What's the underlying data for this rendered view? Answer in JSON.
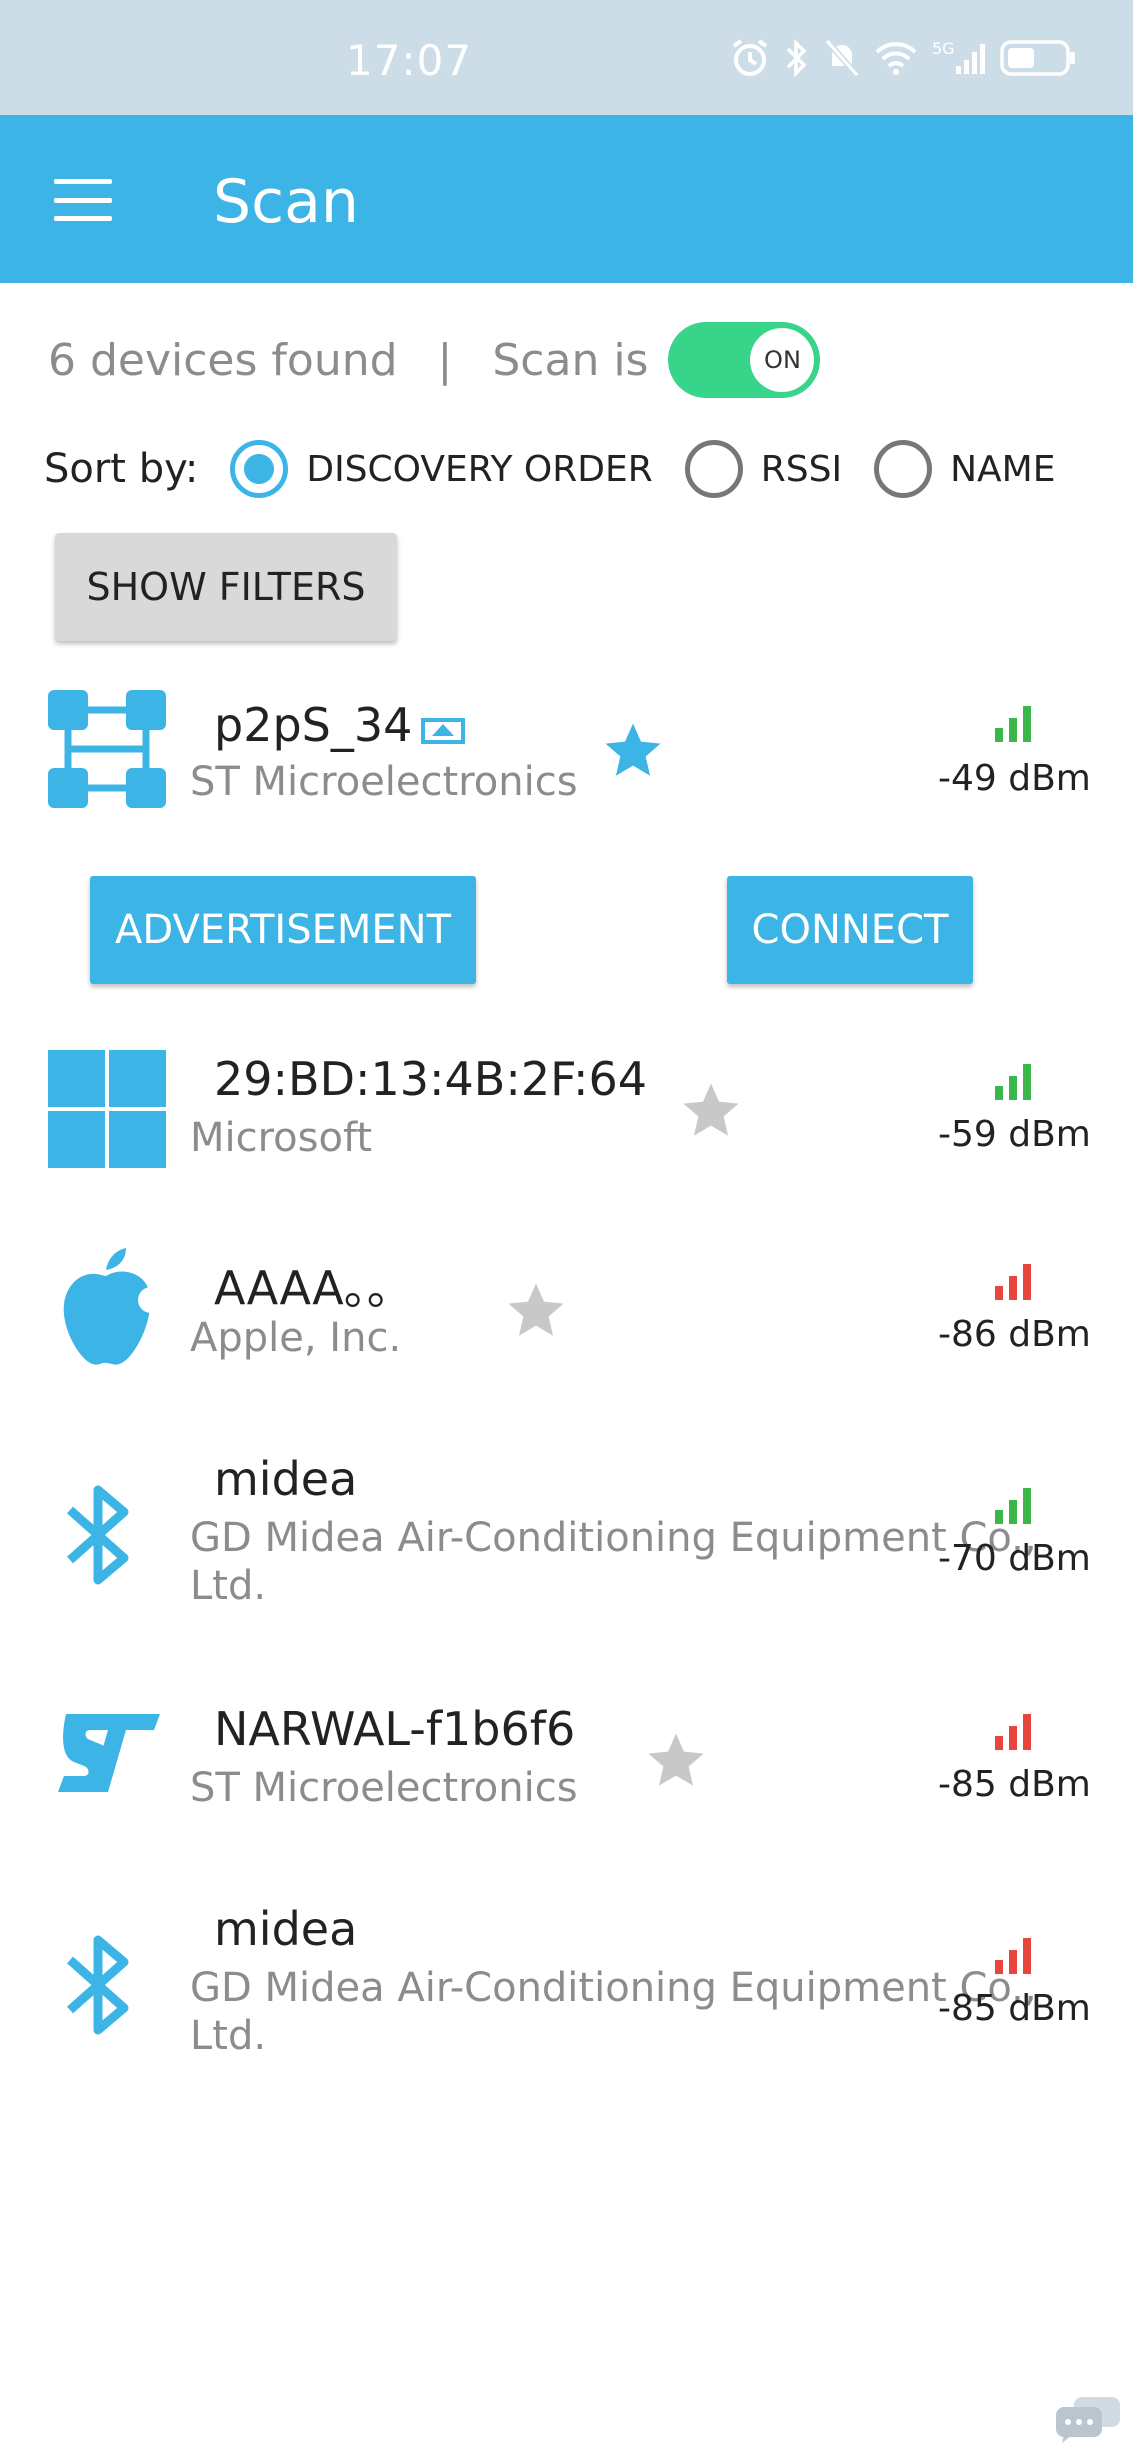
{
  "status_bar": {
    "time": "17:07",
    "icons": [
      "alarm-icon",
      "bluetooth-icon",
      "mute-icon",
      "wifi-icon",
      "5g-signal-icon",
      "battery-icon"
    ]
  },
  "app_bar": {
    "title": "Scan",
    "menu_icon": "hamburger-menu-icon",
    "color": "#3cb4e5"
  },
  "scan_info": {
    "devices_found": "6 devices found",
    "divider": "|",
    "scan_label": "Scan is",
    "toggle_state": "ON",
    "toggle_color": "#38d48a"
  },
  "sort": {
    "label": "Sort by:",
    "options": [
      {
        "label": "DISCOVERY ORDER",
        "selected": true
      },
      {
        "label": "RSSI",
        "selected": false
      },
      {
        "label": "NAME",
        "selected": false
      }
    ]
  },
  "filters_button": "SHOW FILTERS",
  "devices": [
    {
      "name": "p2pS_34",
      "manufacturer": "ST Microelectronics",
      "icon": "network-nodes-icon",
      "favorite": true,
      "rssi": "-49 dBm",
      "signal": "strong",
      "expanded": true,
      "advertisement_label": "ADVERTISEMENT",
      "connect_label": "CONNECT"
    },
    {
      "name": "29:BD:13:4B:2F:64",
      "manufacturer": "Microsoft",
      "icon": "windows-logo-icon",
      "favorite": false,
      "rssi": "-59 dBm",
      "signal": "strong"
    },
    {
      "name": "AAAA。。",
      "manufacturer": "Apple, Inc.",
      "icon": "apple-logo-icon",
      "favorite": false,
      "rssi": "-86 dBm",
      "signal": "weak"
    },
    {
      "name": "midea",
      "manufacturer": "GD Midea Air-Conditioning Equipment Co., Ltd.",
      "icon": "bluetooth-icon",
      "favorite": null,
      "rssi": "-70 dBm",
      "signal": "strong"
    },
    {
      "name": "NARWAL-f1b6f6",
      "manufacturer": "ST Microelectronics",
      "icon": "st-logo-icon",
      "favorite": false,
      "rssi": "-85 dBm",
      "signal": "weak"
    },
    {
      "name": "midea",
      "manufacturer": "GD Midea Air-Conditioning Equipment Co., Ltd.",
      "icon": "bluetooth-icon",
      "favorite": null,
      "rssi": "-85 dBm",
      "signal": "weak"
    }
  ],
  "colors": {
    "accent": "#3cb4e5",
    "signal_strong": "#3cb84a",
    "signal_weak": "#e8463c",
    "star_inactive": "#c8c8c8"
  }
}
